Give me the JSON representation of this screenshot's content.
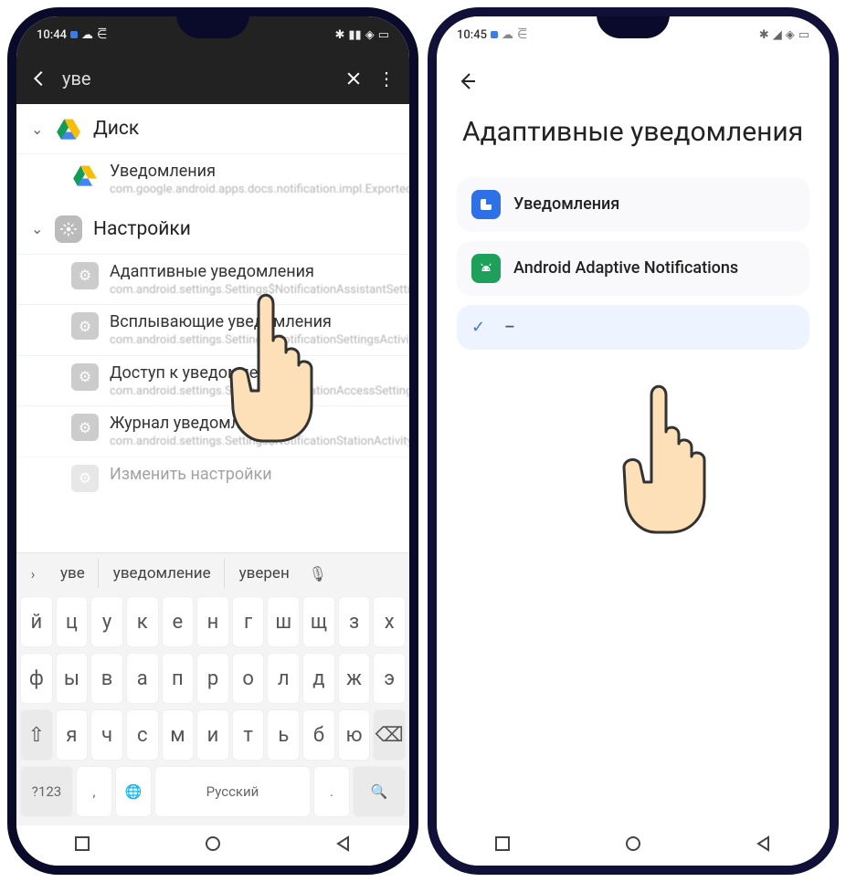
{
  "left": {
    "status": {
      "time": "10:44"
    },
    "search": {
      "query": "уве"
    },
    "groups": [
      {
        "icon": "drive",
        "label": "Диск",
        "items": [
          {
            "title": "Уведомления",
            "sub": "com.google.android.apps.docs.notification.impl.ExportedNotificationHomeActivity",
            "icon": "drive"
          }
        ]
      },
      {
        "icon": "gear",
        "label": "Настройки",
        "items": [
          {
            "title": "Адаптивные уведомления",
            "sub": "com.android.settings.Settings$NotificationAssistantSettingsActivity",
            "icon": "gear"
          },
          {
            "title": "Всплывающие уведомления",
            "sub": "com.android.settings.Settings$NotificationSettingsActivity",
            "icon": "gear"
          },
          {
            "title": "Доступ к уведомлениям",
            "sub": "com.android.settings.Settings$NotificationAccessSettingsActivity",
            "icon": "gear"
          },
          {
            "title": "Журнал уведомлений",
            "sub": "com.android.settings.Settings$NotificationStationActivity",
            "icon": "gear"
          },
          {
            "title": "Изменить настройки",
            "sub": "",
            "icon": "gear"
          }
        ]
      }
    ],
    "suggestions": [
      "уве",
      "уведомление",
      "уверен"
    ],
    "keyboard": {
      "row1": [
        "й",
        "ц",
        "у",
        "к",
        "е",
        "н",
        "г",
        "ш",
        "щ",
        "з",
        "х"
      ],
      "row2": [
        "ф",
        "ы",
        "в",
        "а",
        "п",
        "р",
        "о",
        "л",
        "д",
        "ж",
        "э"
      ],
      "row3_shift": "⇧",
      "row3": [
        "я",
        "ч",
        "с",
        "м",
        "и",
        "т",
        "ь",
        "б",
        "ю"
      ],
      "row3_del": "⌫",
      "bottom": {
        "numkey": "?123",
        "comma": ",",
        "globe": "🌐",
        "space": "Русский",
        "dot": ".",
        "search": "🔍"
      }
    }
  },
  "right": {
    "status": {
      "time": "10:45"
    },
    "title": "Адаптивные уведомления",
    "options": [
      {
        "icon": "notif-blue",
        "label": "Уведомления",
        "sub": ""
      },
      {
        "icon": "android-green",
        "label": "Android Adaptive Notifications",
        "sub": ""
      },
      {
        "icon": "none",
        "label": "–",
        "sub": "",
        "selected": true
      }
    ]
  }
}
